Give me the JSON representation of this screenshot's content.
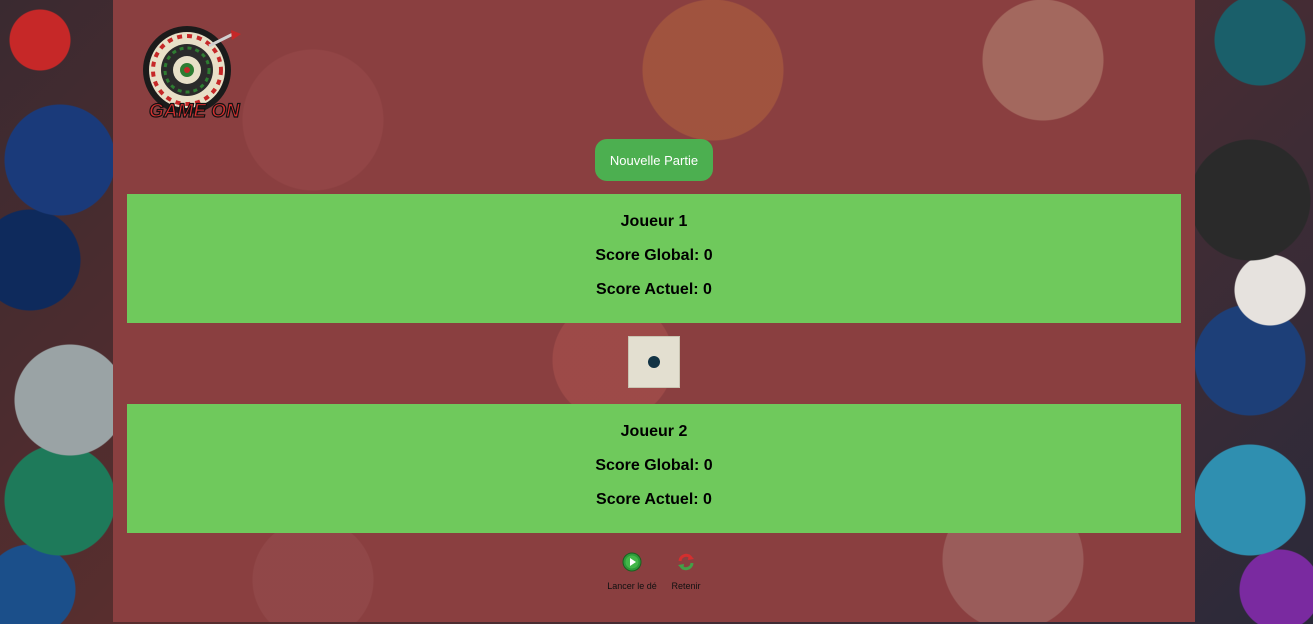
{
  "header": {
    "logo_icon": "dartboard-game-on-logo",
    "logo_text": "GAME ON"
  },
  "controls": {
    "new_game_label": "Nouvelle Partie"
  },
  "players": [
    {
      "name": "Joueur 1",
      "global_score": "Score Global: 0",
      "current_score": "Score Actuel: 0"
    },
    {
      "name": "Joueur 2",
      "global_score": "Score Global: 0",
      "current_score": "Score Actuel: 0"
    }
  ],
  "dice": {
    "value": 1
  },
  "actions": {
    "roll_label": "Lancer le dé",
    "roll_icon": "play-icon",
    "hold_label": "Retenir",
    "hold_icon": "refresh-icon"
  },
  "colors": {
    "panel_bg": "#8a3f40",
    "player_panel": "#6fc95c",
    "button": "#4caf50",
    "dice_face": "#e3dfd0",
    "dice_pip": "#123344"
  }
}
